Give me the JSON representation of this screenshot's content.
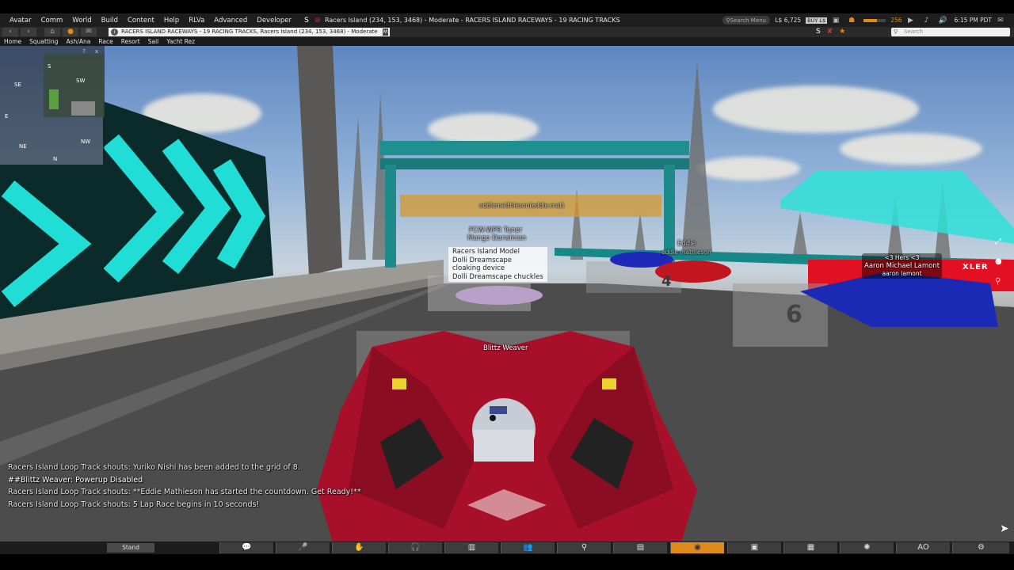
{
  "top_menu": {
    "items": [
      "Avatar",
      "Comm",
      "World",
      "Build",
      "Content",
      "Help",
      "RLVa",
      "Advanced",
      "Developer"
    ],
    "window_title": "Racers Island (234, 153, 3468) - Moderate - RACERS ISLAND RACEWAYS - 19 RACING TRACKS",
    "search_menu_placeholder": "Search Menu",
    "balance": "L$ 6,725",
    "buy_label": "BUY L$",
    "fps_value": "256",
    "clock": "6:15 PM PDT"
  },
  "nav": {
    "location": "RACERS ISLAND RACEWAYS - 19 RACING TRACKS, Racers Island (234, 153, 3468) - Moderate",
    "maturity_badge": "M",
    "search_placeholder": "Search"
  },
  "favorites": [
    "Home",
    "Squatting",
    "Ash/Ana",
    "Race",
    "Resort",
    "Sail",
    "Yacht Rez"
  ],
  "minimap": {
    "directions": {
      "s": "S",
      "se": "SE",
      "sw": "SW",
      "e": "E",
      "ne": "NE",
      "nw": "NW",
      "n": "N"
    },
    "tools": [
      "?",
      "x"
    ]
  },
  "nameplates": {
    "player": "Blittz Weaver",
    "eddie_top": "Eddie",
    "eddie_sub": "eddie mathieson",
    "aaron_title": "<3 Hers <3",
    "aaron_display": "Aaron Michael Lamont",
    "aaron_user": "aaron lamont",
    "dim1": "FCW-WPR Tuner",
    "dim2": "Mango Darwinian",
    "banner": "eddiematthieson(eddie.mat)"
  },
  "hovertext": [
    "Racers Island Model",
    "Dolli Dreamscape",
    "cloaking device",
    "Dolli Dreamscape chuckles"
  ],
  "chat": [
    "Racers Island Loop Track shouts: Yuriko Nishi has been added to the grid of 8.",
    "##Blittz Weaver: Powerup Disabled",
    "Racers Island Loop Track shouts: **Eddie Mathieson has started the countdown. Get Ready!**",
    "Racers Island Loop Track shouts: 5 Lap Race begins in 10 seconds!"
  ],
  "bottom": {
    "stand_label": "Stand",
    "ao_label": "AO"
  },
  "scene_labels": {
    "grid4": "4",
    "grid6": "6",
    "brand": "XLER"
  },
  "colors": {
    "accent": "#e08a1e",
    "glow": "#22e8e0",
    "car_red": "#b0142a",
    "car_blue": "#1c2ab0"
  }
}
